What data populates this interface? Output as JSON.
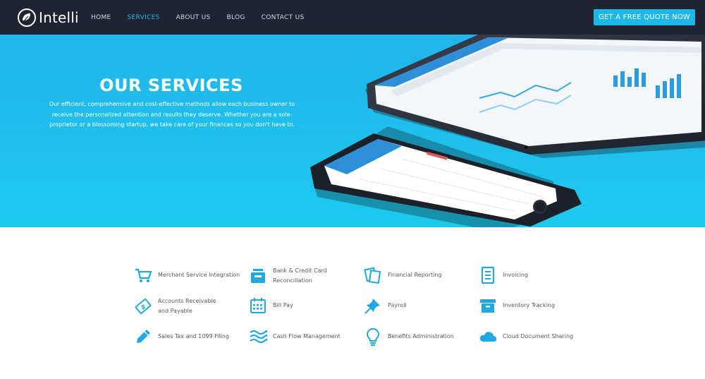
{
  "brand": {
    "name": "Intelli"
  },
  "nav": {
    "items": [
      {
        "label": "HOME",
        "active": false
      },
      {
        "label": "SERVICES",
        "active": true
      },
      {
        "label": "ABOUT US",
        "active": false
      },
      {
        "label": "BLOG",
        "active": false
      },
      {
        "label": "CONTACT US",
        "active": false
      }
    ],
    "cta_label": "GET A FREE QUOTE NOW"
  },
  "hero": {
    "title": "OUR SERVICES",
    "text": "Our efficient, comprehensive and cost-effective methods allow each business owner to receive the personalized attention and results they deserve. Whether you are a sole-proprietor or a blossoming startup, we take care of your finances so you don't have to."
  },
  "services": [
    {
      "label": "Merchant Service Integration",
      "icon": "shopping-cart-icon"
    },
    {
      "label": "Bank & Credit Card Reconciliation",
      "icon": "inbox-tray-icon"
    },
    {
      "label": "Financial Reporting",
      "icon": "documents-icon"
    },
    {
      "label": "Invoicing",
      "icon": "invoice-icon"
    },
    {
      "label": "Accounts Receivable and Payable",
      "icon": "money-bill-icon"
    },
    {
      "label": "Bill Pay",
      "icon": "calendar-icon"
    },
    {
      "label": "Payroll",
      "icon": "pushpin-icon"
    },
    {
      "label": "Inventory Tracking",
      "icon": "archive-box-icon"
    },
    {
      "label": "Sales Tax and 1099 Filing",
      "icon": "pencil-icon"
    },
    {
      "label": "Cash Flow Management",
      "icon": "waves-icon"
    },
    {
      "label": "Benefits Administration",
      "icon": "lightbulb-icon"
    },
    {
      "label": "Cloud Document Sharing",
      "icon": "cloud-icon"
    }
  ],
  "colors": {
    "accent": "#1eb7ea",
    "nav_bg": "#1f2430",
    "icon": "#1fa9e0"
  }
}
